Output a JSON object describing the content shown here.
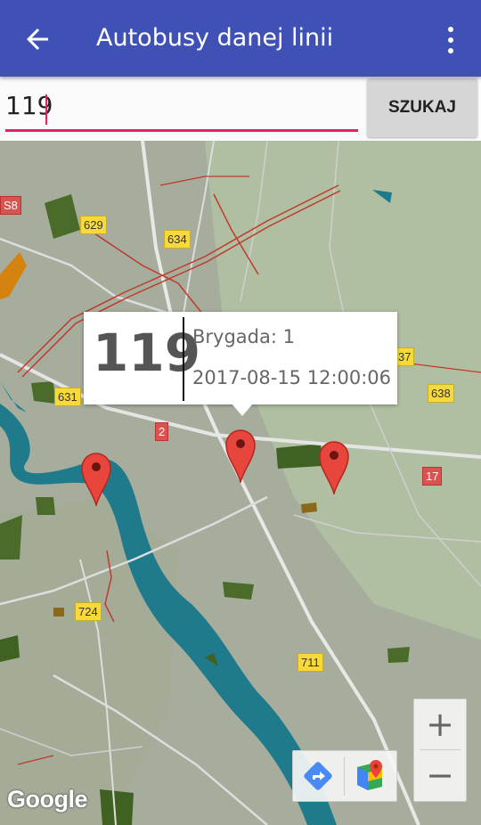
{
  "appbar": {
    "title": "Autobusy danej linii",
    "back_icon": "arrow-back-icon",
    "menu_icon": "more-vert-icon"
  },
  "search": {
    "value": "119",
    "button_label": "SZUKAJ"
  },
  "map": {
    "road_labels": [
      "S8",
      "629",
      "634",
      "37",
      "638",
      "631",
      "2",
      "17",
      "724",
      "711"
    ],
    "popup": {
      "line": "119",
      "brigade": "Brygada: 1",
      "timestamp": "2017-08-15 12:00:06"
    },
    "zoom_in": "+",
    "zoom_out": "−",
    "attribution": "Google",
    "colors": {
      "water": "#1f7b8c",
      "park": "#4a6b2a",
      "marker": "#e8463c",
      "accent": "#e91e63",
      "appbar": "#3f51b5"
    }
  }
}
